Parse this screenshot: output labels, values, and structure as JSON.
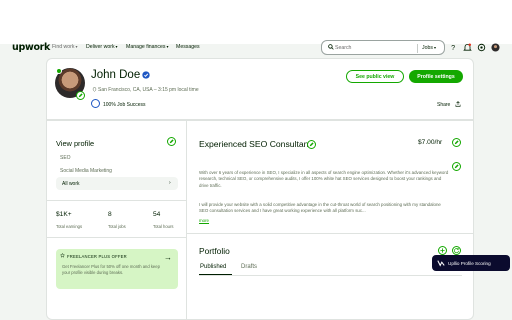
{
  "nav": {
    "logo": "upwork",
    "links": [
      "Find work",
      "Deliver work",
      "Manage finances",
      "Messages"
    ],
    "search_placeholder": "Search",
    "search_scope": "Jobs"
  },
  "profile": {
    "name": "John Doe",
    "location": "San Francisco, CA, USA – 3:15 pm local time",
    "job_success": "100% Job Success",
    "see_public_view": "See public view",
    "profile_settings": "Profile settings",
    "share": "Share"
  },
  "sidebar": {
    "view_profile": "View profile",
    "items": [
      "SEO",
      "Social Media Marketing",
      "All work"
    ],
    "stats": [
      {
        "value": "$1K+",
        "label": "Total earnings"
      },
      {
        "value": "8",
        "label": "Total jobs"
      },
      {
        "value": "54",
        "label": "Total hours"
      }
    ],
    "promo_title": "FREELANCER PLUS OFFER",
    "promo_body": "Get Freelancer Plus for 50% off one month and keep your profile visible during breaks."
  },
  "main": {
    "title": "Experienced SEO Consultant",
    "rate": "$7.00/hr",
    "paragraph1": "With over 6 years of experience in SEO, I specialize in all aspects of search engine optimization. Whether it's advanced keyword research, technical SEO, or comprehensive audits, I offer 100% white hat SEO services designed to boost your rankings and drive traffic.",
    "paragraph2": "I will provide your website with a solid competitive advantage in the cut-throat world of search positioning with my standalone SEO consultation services and I have great working experience with all platform suc...",
    "more": "more",
    "portfolio_title": "Portfolio",
    "tabs": [
      "Published",
      "Drafts"
    ]
  },
  "extension_badge": "Upllio Profile Scoring",
  "colors": {
    "accent": "#14a800",
    "text": "#001e00",
    "muted": "#5e6d55",
    "promo_bg": "#d6f5c5",
    "jss_blue": "#1f57c3"
  }
}
